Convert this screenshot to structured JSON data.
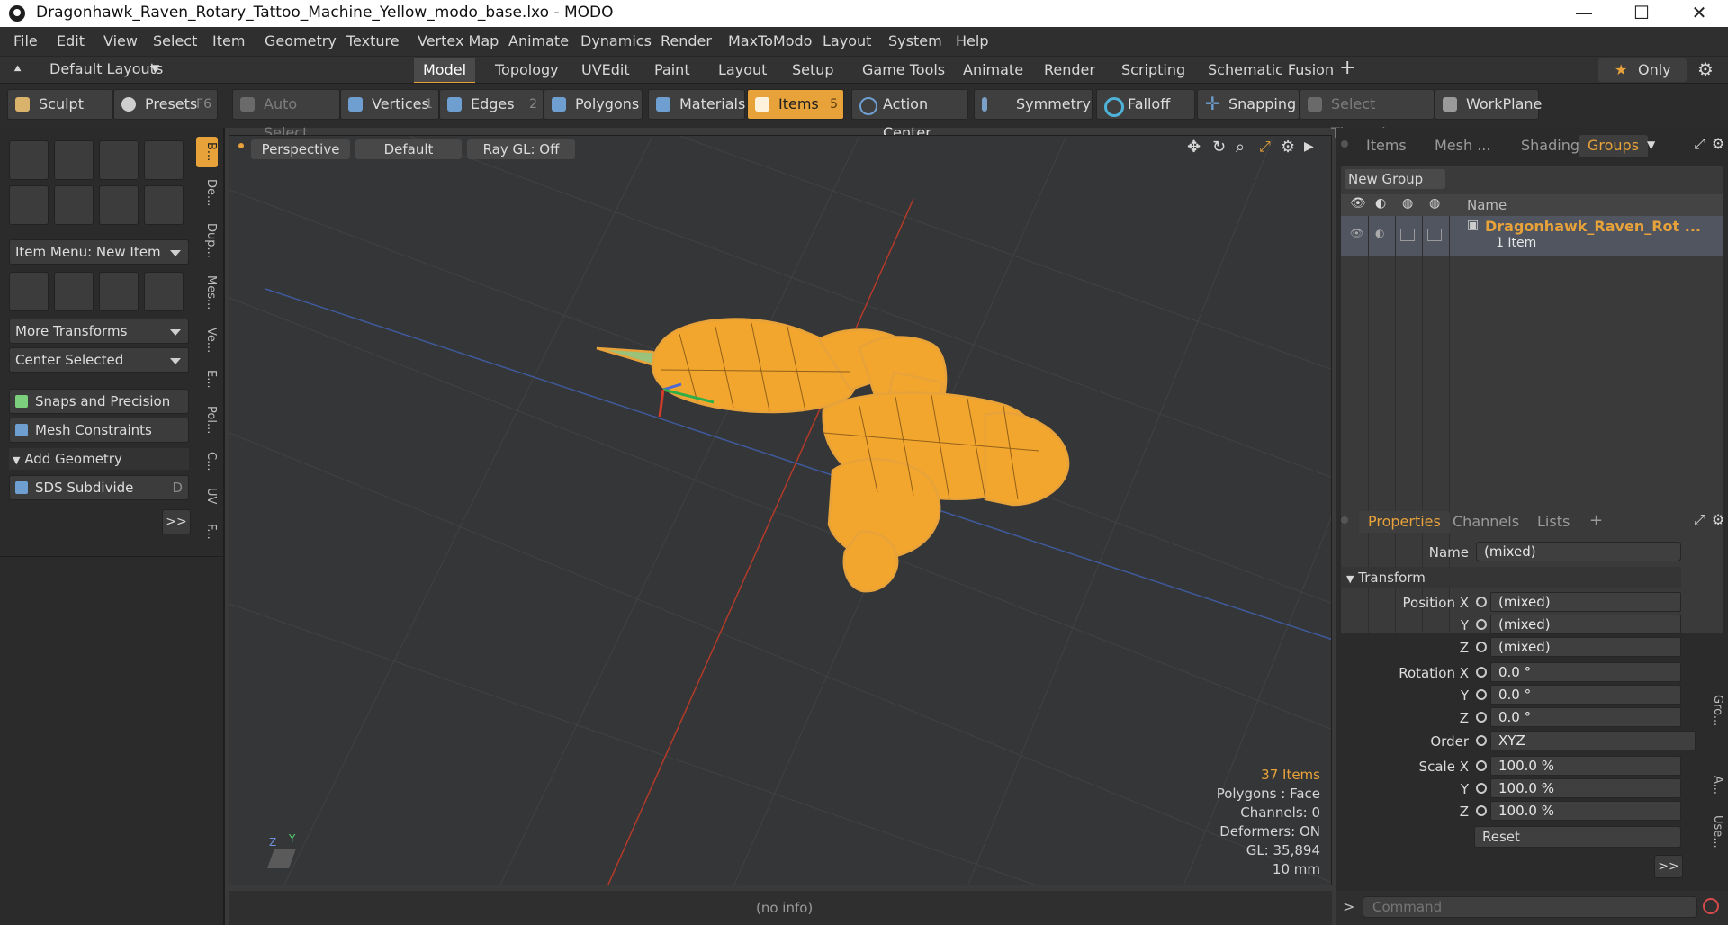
{
  "window": {
    "title": "Dragonhawk_Raven_Rotary_Tattoo_Machine_Yellow_modo_base.lxo - MODO",
    "minimize": "—",
    "maximize": "☐",
    "close": "✕"
  },
  "menu": [
    "File",
    "Edit",
    "View",
    "Select",
    "Item",
    "Geometry",
    "Texture",
    "Vertex Map",
    "Animate",
    "Dynamics",
    "Render",
    "MaxToModo",
    "Layout",
    "System",
    "Help"
  ],
  "layoutbar": {
    "layout_dropdown": "Default Layouts",
    "tabs": [
      "Model",
      "Topology",
      "UVEdit",
      "Paint",
      "Layout",
      "Setup",
      "Game Tools",
      "Animate",
      "Render",
      "Scripting",
      "Schematic Fusion"
    ],
    "active_tab": "Model",
    "add": "+",
    "only": "Only"
  },
  "toolbar": {
    "sculpt": "Sculpt",
    "presets": "Presets",
    "presets_key": "F6",
    "auto_select": "Auto Select",
    "vertices": "Vertices",
    "vertices_count": "1",
    "edges": "Edges",
    "edges_count": "2",
    "polygons": "Polygons",
    "materials": "Materials",
    "items": "Items",
    "items_count": "5",
    "action_center": "Action Center",
    "symmetry": "Symmetry",
    "falloff": "Falloff",
    "snapping": "Snapping",
    "select_through": "Select Through",
    "workplane": "WorkPlane"
  },
  "leftpanel": {
    "item_menu": "Item Menu: New Item",
    "more_transforms": "More Transforms",
    "center_selected": "Center Selected",
    "snaps": "Snaps and Precision",
    "mesh_constraints": "Mesh Constraints",
    "add_geometry": "Add Geometry",
    "sds_subdivide": "SDS Subdivide",
    "sds_key": "D",
    "more": ">>",
    "vtabs": [
      "B...",
      "De...",
      "Dup...",
      "Mes...",
      "Ve...",
      "E...",
      "Pol...",
      "C...",
      "UV",
      "F..."
    ]
  },
  "viewport": {
    "view": "Perspective",
    "shading": "Default",
    "raygl": "Ray GL: Off",
    "info": {
      "items": "37 Items",
      "polygons": "Polygons : Face",
      "channels": "Channels: 0",
      "deformers": "Deformers: ON",
      "gl": "GL: 35,894",
      "scale": "10 mm"
    },
    "axis_y": "Y",
    "axis_z": "Z",
    "accent": "#e8a23a"
  },
  "groups_panel": {
    "tabs": [
      "Items",
      "Mesh ...",
      "Shading",
      "Groups"
    ],
    "active_tab": "Groups",
    "new_group": "New Group",
    "name_header": "Name",
    "group_name": "Dragonhawk_Raven_Rot ...",
    "group_count": "1 Item"
  },
  "properties_panel": {
    "tabs": [
      "Properties",
      "Channels",
      "Lists"
    ],
    "active_tab": "Properties",
    "add": "+",
    "name_label": "Name",
    "name_value": "(mixed)",
    "transform": "Transform",
    "position_label": "Position X",
    "position": [
      "(mixed)",
      "(mixed)",
      "(mixed)"
    ],
    "rotation_label": "Rotation X",
    "rotation": [
      "0.0 °",
      "0.0 °",
      "0.0 °"
    ],
    "order_label": "Order",
    "order": "XYZ",
    "scale_label": "Scale X",
    "scale": [
      "100.0 %",
      "100.0 %",
      "100.0 %"
    ],
    "y_label": "Y",
    "z_label": "Z",
    "reset": "Reset",
    "more": ">>",
    "side_tabs": [
      "Gro...",
      "A...",
      "Use..."
    ]
  },
  "status": {
    "info": "(no info)",
    "command_prompt": ">",
    "command_placeholder": "Command"
  }
}
